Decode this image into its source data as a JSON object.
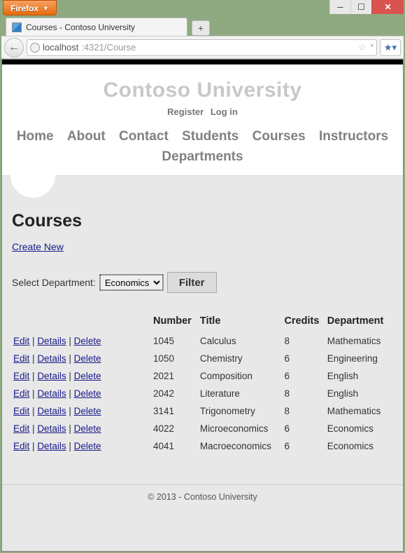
{
  "browser": {
    "name": "Firefox",
    "tab_title": "Courses - Contoso University",
    "url_host": "localhost",
    "url_port_path": ":4321/Course"
  },
  "header": {
    "brand": "Contoso University",
    "register": "Register",
    "login": "Log in",
    "nav": {
      "home": "Home",
      "about": "About",
      "contact": "Contact",
      "students": "Students",
      "courses": "Courses",
      "instructors": "Instructors",
      "departments": "Departments"
    }
  },
  "page": {
    "title": "Courses",
    "create_new": "Create New",
    "select_dept_label": "Select Department:",
    "selected_department": "Economics",
    "filter_button": "Filter",
    "columns": {
      "number": "Number",
      "title": "Title",
      "credits": "Credits",
      "department": "Department"
    },
    "action_labels": {
      "edit": "Edit",
      "details": "Details",
      "delete": "Delete"
    },
    "rows": [
      {
        "number": "1045",
        "title": "Calculus",
        "credits": "8",
        "department": "Mathematics"
      },
      {
        "number": "1050",
        "title": "Chemistry",
        "credits": "6",
        "department": "Engineering"
      },
      {
        "number": "2021",
        "title": "Composition",
        "credits": "6",
        "department": "English"
      },
      {
        "number": "2042",
        "title": "Literature",
        "credits": "8",
        "department": "English"
      },
      {
        "number": "3141",
        "title": "Trigonometry",
        "credits": "8",
        "department": "Mathematics"
      },
      {
        "number": "4022",
        "title": "Microeconomics",
        "credits": "6",
        "department": "Economics"
      },
      {
        "number": "4041",
        "title": "Macroeconomics",
        "credits": "6",
        "department": "Economics"
      }
    ]
  },
  "footer": {
    "text": "© 2013 - Contoso University"
  }
}
